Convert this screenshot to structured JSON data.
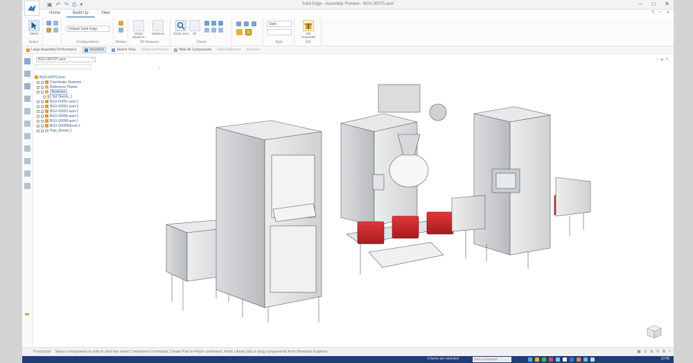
{
  "window": {
    "title": "Solid Edge - Assembly Preview - BGX-00070.asm",
    "controls": [
      "–",
      "□",
      "✕"
    ]
  },
  "ribbon": {
    "tabs": [
      {
        "label": "Home",
        "active": false
      },
      {
        "label": "Build Up",
        "active": true
      },
      {
        "label": "View",
        "active": false
      }
    ],
    "help_icons": [
      "?",
      "⌃",
      "×"
    ],
    "groups": [
      {
        "label": "Select",
        "button": "Select"
      },
      {
        "label": "Configurations",
        "combo": "Default Solid Edge"
      },
      {
        "label": "Modes",
        "note": "2D Measure"
      },
      {
        "label": "3D Measure",
        "buttons": [
          "Smart Measure",
          "Measure"
        ]
      },
      {
        "label": "Check",
        "buttons": [
          "Zoom Area",
          "Fit"
        ]
      },
      {
        "label": "Style",
        "combo": "Style"
      },
      {
        "label": "Style",
        "note": "Gallery"
      },
      {
        "label": "Gift",
        "button": "Gift Assembler"
      }
    ]
  },
  "subbar": {
    "items": [
      {
        "label": "Large Assembly Performance",
        "active": false
      },
      {
        "label": "Simplified",
        "active": true
      },
      {
        "label": "Sketch View",
        "active": false
      },
      {
        "label": "Reference Planes",
        "active": false,
        "dim": true
      },
      {
        "label": "Hide All Components",
        "active": false
      },
      {
        "label": "Select Adjacent",
        "active": false,
        "dim": true
      },
      {
        "label": "Interface",
        "active": false,
        "dim": true
      }
    ]
  },
  "pathfinder": {
    "tab_label": "BGX-00070T.asm",
    "close": "×",
    "rows": [
      {
        "label": "BGX-00070.asm",
        "indent": 0,
        "selected": false
      },
      {
        "label": "Coordinate Systems",
        "indent": 1,
        "selected": false
      },
      {
        "label": "Reference Planes",
        "indent": 1,
        "selected": false
      },
      {
        "label": "Sketches",
        "indent": 1,
        "selected": true
      },
      {
        "label": "Sld Sketch_1",
        "indent": 2,
        "selected": false
      },
      {
        "label": "BGX-00051.asm:1",
        "indent": 1,
        "selected": false
      },
      {
        "label": "BGX-00051.asm:1",
        "indent": 1,
        "selected": false
      },
      {
        "label": "BGX-00052.asm:1",
        "indent": 1,
        "selected": false
      },
      {
        "label": "BGX-00056.asm:1",
        "indent": 1,
        "selected": false
      },
      {
        "label": "BGX-00058.asm:1",
        "indent": 1,
        "selected": false
      },
      {
        "label": "BGX-00050Mover:1",
        "indent": 1,
        "selected": false
      },
      {
        "label": "Pipe_Border:1",
        "indent": 1,
        "selected": false
      }
    ]
  },
  "canvas": {
    "controls": [
      "↕",
      "▾",
      "×"
    ]
  },
  "status": {
    "label": "Promptbar",
    "prompt": "Select components to edit or click the Insert Component command, Create Part In-Place command, Parts Library tab or drag components from Windows Explorer.",
    "right_icons": [
      "▣",
      "⊙",
      "⊕",
      "⚲",
      "⊞",
      "⌂"
    ]
  },
  "taskbar": {
    "selection": "0 items are selected",
    "find": "Find a command",
    "clock": "10:45"
  },
  "colors": {
    "accent": "#2d5d8a",
    "taskbar": "#1f3e73",
    "machine_red": "#c8262a",
    "frame": "#c9ced4"
  }
}
